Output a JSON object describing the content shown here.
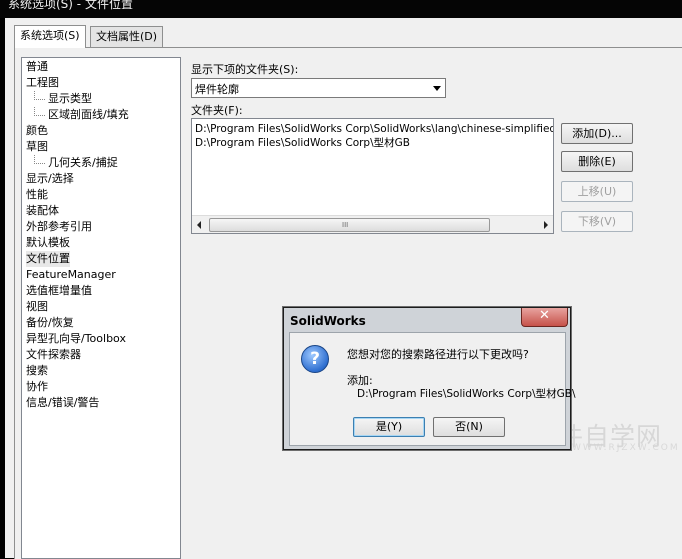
{
  "window": {
    "title": "系统选项(S) - 文件位置"
  },
  "tabs": [
    {
      "label": "系统选项(S)",
      "active": true
    },
    {
      "label": "文档属性(D)",
      "active": false
    }
  ],
  "tree": [
    {
      "label": "普通",
      "level": 0
    },
    {
      "label": "工程图",
      "level": 0
    },
    {
      "label": "显示类型",
      "level": 1
    },
    {
      "label": "区域剖面线/填充",
      "level": 1
    },
    {
      "label": "颜色",
      "level": 0
    },
    {
      "label": "草图",
      "level": 0
    },
    {
      "label": "几何关系/捕捉",
      "level": 1
    },
    {
      "label": "显示/选择",
      "level": 0
    },
    {
      "label": "性能",
      "level": 0
    },
    {
      "label": "装配体",
      "level": 0
    },
    {
      "label": "外部参考引用",
      "level": 0
    },
    {
      "label": "默认模板",
      "level": 0
    },
    {
      "label": "文件位置",
      "level": 0,
      "selected": true
    },
    {
      "label": "FeatureManager",
      "level": 0
    },
    {
      "label": "选值框增量值",
      "level": 0
    },
    {
      "label": "视图",
      "level": 0
    },
    {
      "label": "备份/恢复",
      "level": 0
    },
    {
      "label": "异型孔向导/Toolbox",
      "level": 0
    },
    {
      "label": "文件探索器",
      "level": 0
    },
    {
      "label": "搜索",
      "level": 0
    },
    {
      "label": "协作",
      "level": 0
    },
    {
      "label": "信息/错误/警告",
      "level": 0
    }
  ],
  "show_folders": {
    "label": "显示下项的文件夹(S):",
    "selected": "焊件轮廓"
  },
  "folders": {
    "label": "文件夹(F):",
    "items": [
      "D:\\Program Files\\SolidWorks Corp\\SolidWorks\\lang\\chinese-simplified\\weldm",
      "D:\\Program Files\\SolidWorks Corp\\型材GB"
    ],
    "scroll_grip": "III"
  },
  "buttons": {
    "add": "添加(D)...",
    "delete": "删除(E)",
    "move_up": "上移(U)",
    "move_down": "下移(V)"
  },
  "dialog": {
    "title": "SolidWorks",
    "close": "✕",
    "icon": "?",
    "message": "您想对您的搜索路径进行以下更改吗?",
    "add_label": "添加:",
    "add_path": "D:\\Program Files\\SolidWorks Corp\\型材GB\\",
    "yes": "是(Y)",
    "no": "否(N)"
  },
  "watermark": {
    "text": "软件自学网",
    "sub": "WWW.RJZXW.COM"
  }
}
